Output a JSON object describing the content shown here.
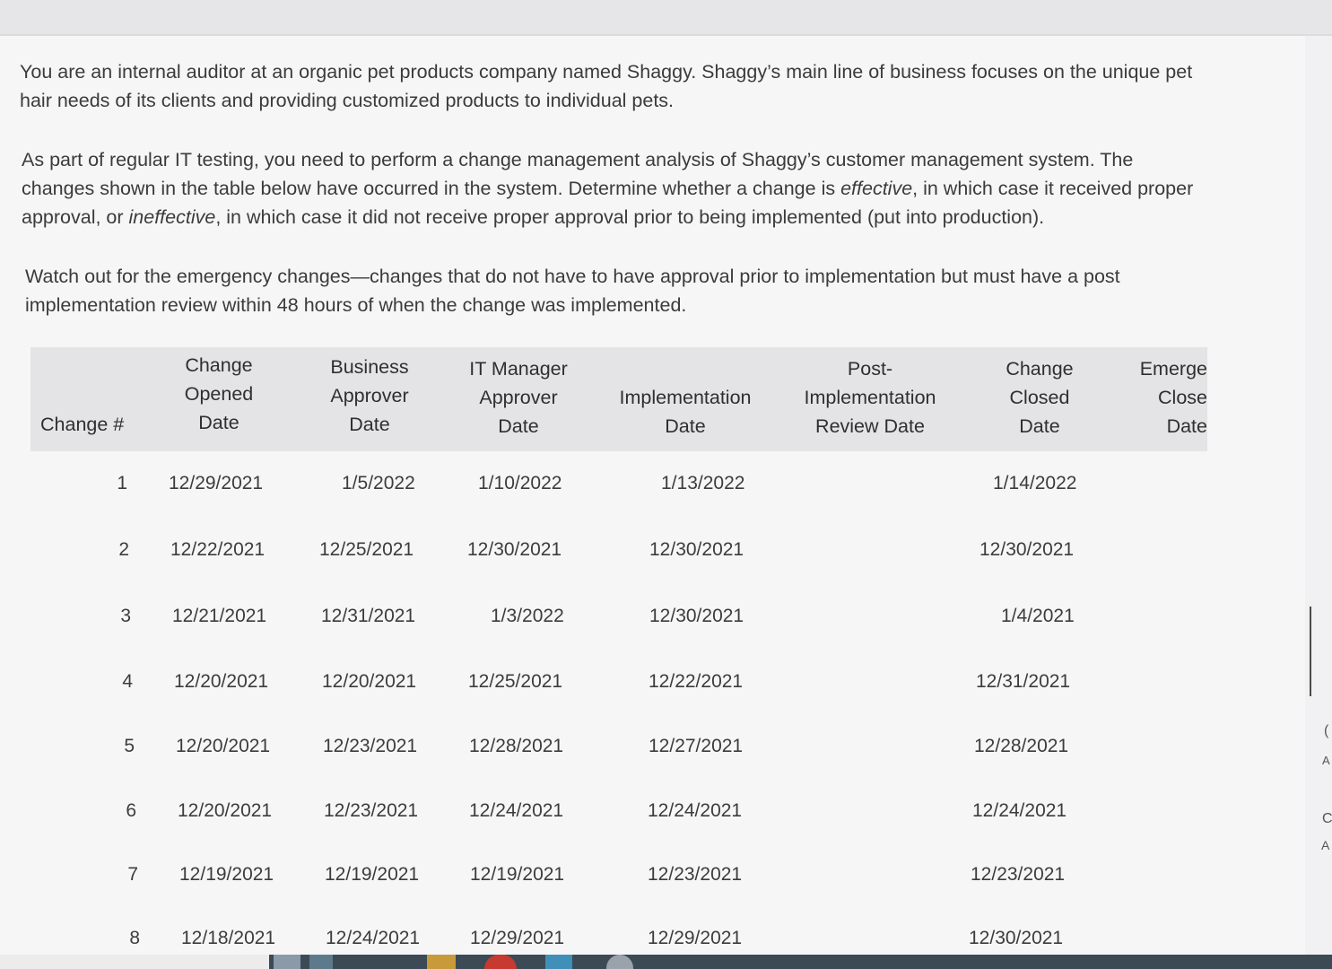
{
  "intro": {
    "paragraph1": "You are an internal auditor at an organic pet products company named Shaggy. Shaggy’s main line of business focuses on the unique pet hair needs of its clients and providing customized products to individual pets.",
    "paragraph2_before_effective": "As part of regular IT testing, you need to perform a change management analysis of Shaggy’s customer management system. The changes shown in the table below have occurred in the system. Determine whether a change is ",
    "effective": "effective",
    "paragraph2_middle": ", in which case it received proper approval, or ",
    "ineffective": "ineffective",
    "paragraph2_after": ", in which case it did not receive proper approval prior to being implemented (put into production).",
    "paragraph3": "Watch out for the emergency changes—changes that do not have to have approval prior to implementation but must have a post implementation review within 48 hours of when the change was implemented."
  },
  "table": {
    "headers": {
      "change_no": "Change #",
      "opened": [
        "Change",
        "Opened",
        "Date"
      ],
      "business": [
        "Business",
        "Approver",
        "Date"
      ],
      "it_manager": [
        "IT Manager",
        "Approver",
        "Date"
      ],
      "implementation": [
        "Implementation",
        "Date"
      ],
      "post_impl": [
        "Post-",
        "Implementation",
        "Review Date"
      ],
      "closed": [
        "Change",
        "Closed",
        "Date"
      ],
      "emergency": [
        "Emerge",
        "Close",
        "Date"
      ]
    },
    "rows": [
      {
        "no": "1",
        "opened": "12/29/2021",
        "business": "1/5/2022",
        "it": "1/10/2022",
        "impl": "1/13/2022",
        "post": "",
        "closed": "1/14/2022"
      },
      {
        "no": "2",
        "opened": "12/22/2021",
        "business": "12/25/2021",
        "it": "12/30/2021",
        "impl": "12/30/2021",
        "post": "",
        "closed": "12/30/2021"
      },
      {
        "no": "3",
        "opened": "12/21/2021",
        "business": "12/31/2021",
        "it": "1/3/2022",
        "impl": "12/30/2021",
        "post": "",
        "closed": "1/4/2021"
      },
      {
        "no": "4",
        "opened": "12/20/2021",
        "business": "12/20/2021",
        "it": "12/25/2021",
        "impl": "12/22/2021",
        "post": "",
        "closed": "12/31/2021"
      },
      {
        "no": "5",
        "opened": "12/20/2021",
        "business": "12/23/2021",
        "it": "12/28/2021",
        "impl": "12/27/2021",
        "post": "",
        "closed": "12/28/2021"
      },
      {
        "no": "6",
        "opened": "12/20/2021",
        "business": "12/23/2021",
        "it": "12/24/2021",
        "impl": "12/24/2021",
        "post": "",
        "closed": "12/24/2021"
      },
      {
        "no": "7",
        "opened": "12/19/2021",
        "business": "12/19/2021",
        "it": "12/19/2021",
        "impl": "12/23/2021",
        "post": "",
        "closed": "12/23/2021"
      },
      {
        "no": "8",
        "opened": "12/18/2021",
        "business": "12/24/2021",
        "it": "12/29/2021",
        "impl": "12/29/2021",
        "post": "",
        "closed": "12/30/2021"
      }
    ]
  },
  "edge_glyphs": [
    "(",
    "A",
    "C",
    "A"
  ],
  "colors": {
    "page_bg": "#f6f6f7",
    "header_bg": "#e4e4e6",
    "text": "#3b3b3b",
    "taskbar": "#3b4a55"
  }
}
